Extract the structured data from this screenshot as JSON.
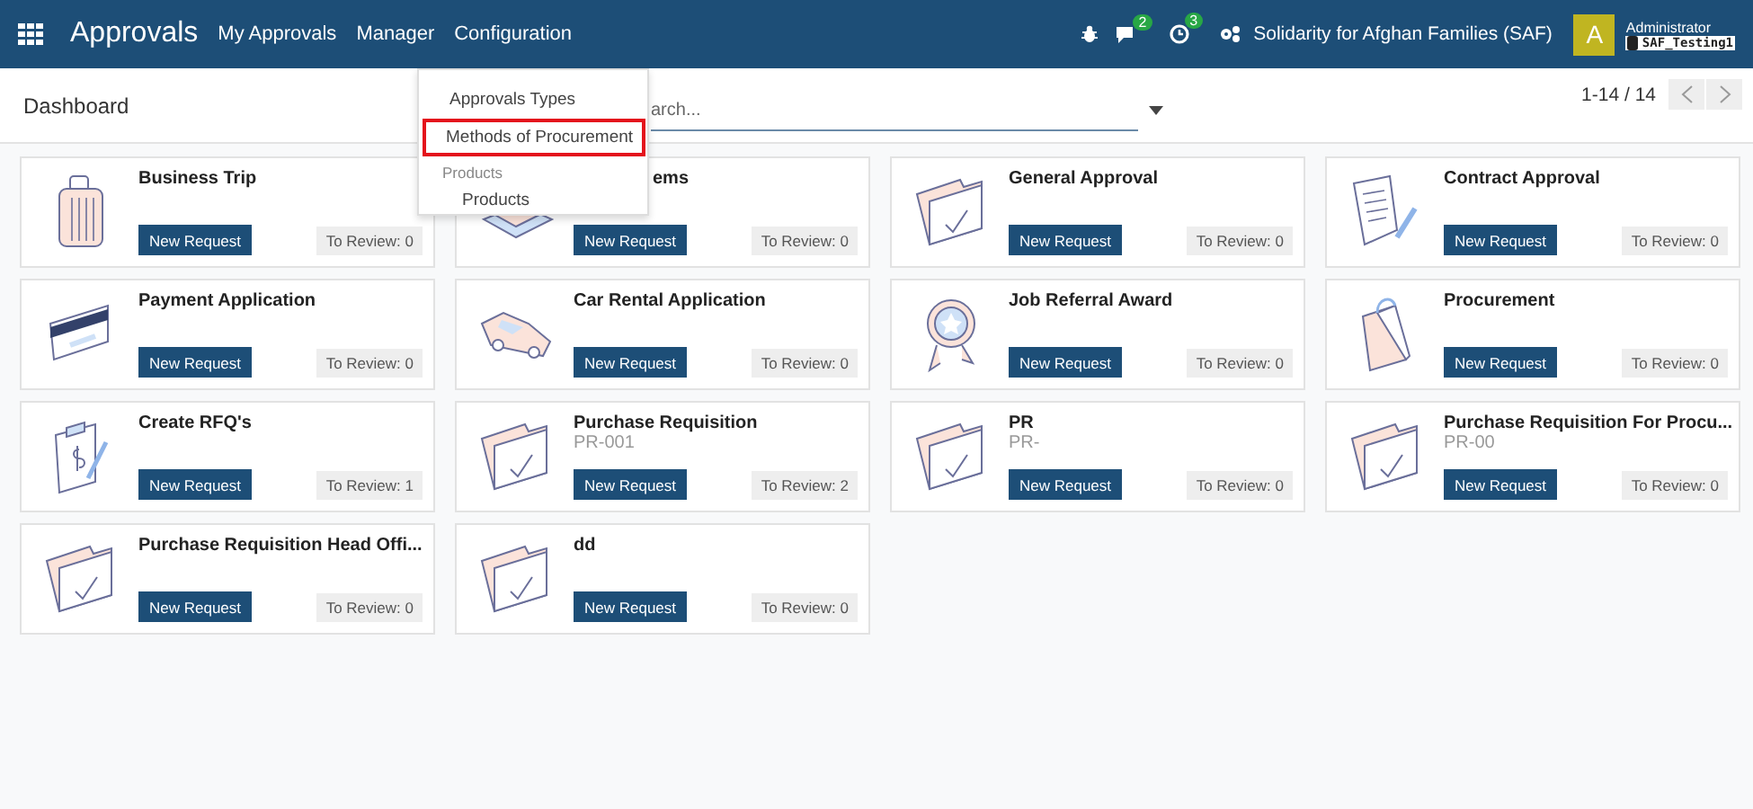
{
  "navbar": {
    "app_title": "Approvals",
    "menu": [
      "My Approvals",
      "Manager",
      "Configuration"
    ],
    "chat_count": "2",
    "activity_count": "3",
    "company": "Solidarity for Afghan Families (SAF)",
    "avatar_letter": "A",
    "user": "Administrator",
    "database": "SAF_Testing1"
  },
  "control_panel": {
    "breadcrumb": "Dashboard",
    "search": {
      "placeholder": "arch..."
    },
    "pager": "1-14 / 14"
  },
  "dropdown": {
    "items": [
      {
        "kind": "item",
        "label": "Approvals Types",
        "highlighted": false
      },
      {
        "kind": "item",
        "label": "Methods of Procurement",
        "highlighted": true
      },
      {
        "kind": "header",
        "label": "Products"
      },
      {
        "kind": "subitem",
        "label": "Products"
      }
    ]
  },
  "cards": [
    {
      "title": "Business Trip",
      "button": "New Request",
      "review": "To Review: 0"
    },
    {
      "title": "ems",
      "covered": true,
      "button": "New Request",
      "review": "To Review: 0"
    },
    {
      "title": "General Approval",
      "button": "New Request",
      "review": "To Review: 0"
    },
    {
      "title": "Contract Approval",
      "button": "New Request",
      "review": "To Review: 0"
    },
    {
      "title": "Payment Application",
      "button": "New Request",
      "review": "To Review: 0"
    },
    {
      "title": "Car Rental Application",
      "button": "New Request",
      "review": "To Review: 0"
    },
    {
      "title": "Job Referral Award",
      "button": "New Request",
      "review": "To Review: 0"
    },
    {
      "title": "Procurement",
      "button": "New Request",
      "review": "To Review: 0"
    },
    {
      "title": "Create RFQ's",
      "button": "New Request",
      "review": "To Review: 1"
    },
    {
      "title": "Purchase Requisition",
      "subtitle": "PR-001",
      "button": "New Request",
      "review": "To Review: 2"
    },
    {
      "title": "PR",
      "subtitle": "PR-",
      "button": "New Request",
      "review": "To Review: 0"
    },
    {
      "title": "Purchase Requisition For Procu...",
      "subtitle": "PR-00",
      "button": "New Request",
      "review": "To Review: 0"
    },
    {
      "title": "Purchase Requisition Head Offi...",
      "button": "New Request",
      "review": "To Review: 0"
    },
    {
      "title": "dd",
      "button": "New Request",
      "review": "To Review: 0"
    }
  ]
}
